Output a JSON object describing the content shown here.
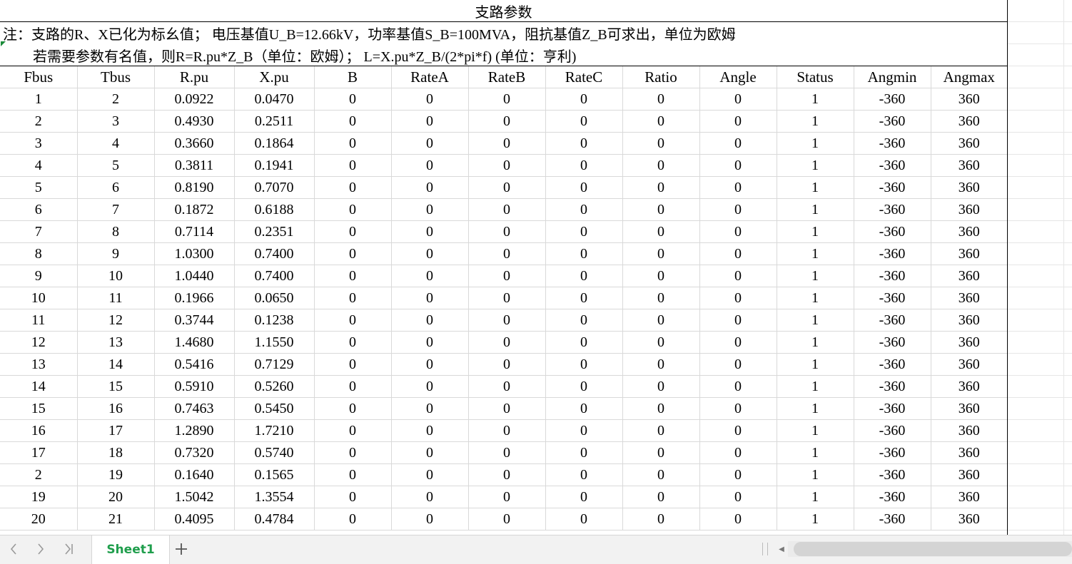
{
  "sheet": {
    "title": "支路参数",
    "note_line1": "注：支路的R、X已化为标幺值； 电压基值U_B=12.66kV，功率基值S_B=100MVA，阻抗基值Z_B可求出，单位为欧姆",
    "note_line2": "若需要参数有名值，则R=R.pu*Z_B（单位：欧姆）； L=X.pu*Z_B/(2*pi*f) (单位：亨利)",
    "headers": [
      "Fbus",
      "Tbus",
      "R.pu",
      "X.pu",
      "B",
      "RateA",
      "RateB",
      "RateC",
      "Ratio",
      "Angle",
      "Status",
      "Angmin",
      "Angmax"
    ],
    "rows": [
      [
        "1",
        "2",
        "0.0922",
        "0.0470",
        "0",
        "0",
        "0",
        "0",
        "0",
        "0",
        "1",
        "-360",
        "360"
      ],
      [
        "2",
        "3",
        "0.4930",
        "0.2511",
        "0",
        "0",
        "0",
        "0",
        "0",
        "0",
        "1",
        "-360",
        "360"
      ],
      [
        "3",
        "4",
        "0.3660",
        "0.1864",
        "0",
        "0",
        "0",
        "0",
        "0",
        "0",
        "1",
        "-360",
        "360"
      ],
      [
        "4",
        "5",
        "0.3811",
        "0.1941",
        "0",
        "0",
        "0",
        "0",
        "0",
        "0",
        "1",
        "-360",
        "360"
      ],
      [
        "5",
        "6",
        "0.8190",
        "0.7070",
        "0",
        "0",
        "0",
        "0",
        "0",
        "0",
        "1",
        "-360",
        "360"
      ],
      [
        "6",
        "7",
        "0.1872",
        "0.6188",
        "0",
        "0",
        "0",
        "0",
        "0",
        "0",
        "1",
        "-360",
        "360"
      ],
      [
        "7",
        "8",
        "0.7114",
        "0.2351",
        "0",
        "0",
        "0",
        "0",
        "0",
        "0",
        "1",
        "-360",
        "360"
      ],
      [
        "8",
        "9",
        "1.0300",
        "0.7400",
        "0",
        "0",
        "0",
        "0",
        "0",
        "0",
        "1",
        "-360",
        "360"
      ],
      [
        "9",
        "10",
        "1.0440",
        "0.7400",
        "0",
        "0",
        "0",
        "0",
        "0",
        "0",
        "1",
        "-360",
        "360"
      ],
      [
        "10",
        "11",
        "0.1966",
        "0.0650",
        "0",
        "0",
        "0",
        "0",
        "0",
        "0",
        "1",
        "-360",
        "360"
      ],
      [
        "11",
        "12",
        "0.3744",
        "0.1238",
        "0",
        "0",
        "0",
        "0",
        "0",
        "0",
        "1",
        "-360",
        "360"
      ],
      [
        "12",
        "13",
        "1.4680",
        "1.1550",
        "0",
        "0",
        "0",
        "0",
        "0",
        "0",
        "1",
        "-360",
        "360"
      ],
      [
        "13",
        "14",
        "0.5416",
        "0.7129",
        "0",
        "0",
        "0",
        "0",
        "0",
        "0",
        "1",
        "-360",
        "360"
      ],
      [
        "14",
        "15",
        "0.5910",
        "0.5260",
        "0",
        "0",
        "0",
        "0",
        "0",
        "0",
        "1",
        "-360",
        "360"
      ],
      [
        "15",
        "16",
        "0.7463",
        "0.5450",
        "0",
        "0",
        "0",
        "0",
        "0",
        "0",
        "1",
        "-360",
        "360"
      ],
      [
        "16",
        "17",
        "1.2890",
        "1.7210",
        "0",
        "0",
        "0",
        "0",
        "0",
        "0",
        "1",
        "-360",
        "360"
      ],
      [
        "17",
        "18",
        "0.7320",
        "0.5740",
        "0",
        "0",
        "0",
        "0",
        "0",
        "0",
        "1",
        "-360",
        "360"
      ],
      [
        "2",
        "19",
        "0.1640",
        "0.1565",
        "0",
        "0",
        "0",
        "0",
        "0",
        "0",
        "1",
        "-360",
        "360"
      ],
      [
        "19",
        "20",
        "1.5042",
        "1.3554",
        "0",
        "0",
        "0",
        "0",
        "0",
        "0",
        "1",
        "-360",
        "360"
      ],
      [
        "20",
        "21",
        "0.4095",
        "0.4784",
        "0",
        "0",
        "0",
        "0",
        "0",
        "0",
        "1",
        "-360",
        "360"
      ]
    ]
  },
  "tabbar": {
    "nav_prev_icon": "chevron-left-icon",
    "nav_next_icon": "chevron-right-icon",
    "nav_last_icon": "chevron-last-icon",
    "sheet_tab": "Sheet1",
    "add_icon": "plus-icon",
    "accent_color": "#1f9e4c"
  }
}
